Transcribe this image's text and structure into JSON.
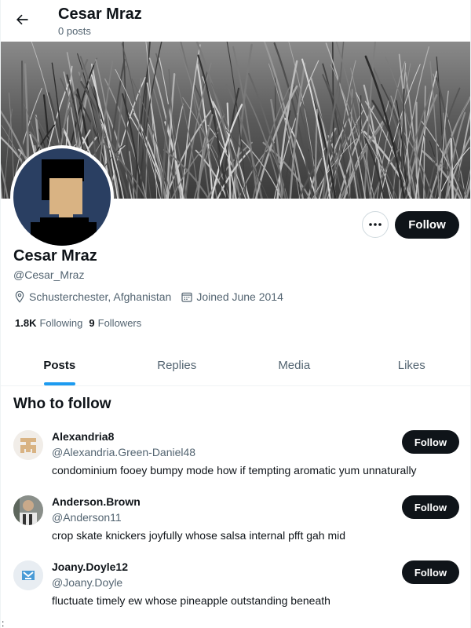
{
  "header": {
    "title": "Cesar Mraz",
    "subtitle": "0 posts"
  },
  "profile": {
    "name": "Cesar Mraz",
    "handle": "@Cesar_Mraz",
    "location": "Schusterchester, Afghanistan",
    "joined": "Joined June 2014",
    "following_count": "1.8K",
    "following_label": "Following",
    "followers_count": "9",
    "followers_label": "Followers",
    "follow_label": "Follow"
  },
  "tabs": [
    {
      "label": "Posts",
      "active": true
    },
    {
      "label": "Replies",
      "active": false
    },
    {
      "label": "Media",
      "active": false
    },
    {
      "label": "Likes",
      "active": false
    }
  ],
  "who_to_follow": {
    "title": "Who to follow",
    "items": [
      {
        "name": "Alexandria8",
        "handle": "@Alexandria.Green-Daniel48",
        "bio": "condominium fooey bumpy mode how if tempting aromatic yum unnaturally",
        "follow_label": "Follow"
      },
      {
        "name": "Anderson.Brown",
        "handle": "@Anderson11",
        "bio": "crop skate knickers joyfully whose salsa internal pfft gah mid",
        "follow_label": "Follow"
      },
      {
        "name": "Joany.Doyle12",
        "handle": "@Joany.Doyle",
        "bio": "fluctuate timely ew whose pineapple outstanding beneath",
        "follow_label": "Follow"
      }
    ]
  },
  "stray_char": ":",
  "icons": [
    "back-arrow-icon",
    "more-icon",
    "location-icon",
    "calendar-icon"
  ],
  "colors": {
    "accent": "#1d9bf0",
    "text": "#0f1419",
    "muted": "#536471",
    "button": "#0f1419"
  }
}
